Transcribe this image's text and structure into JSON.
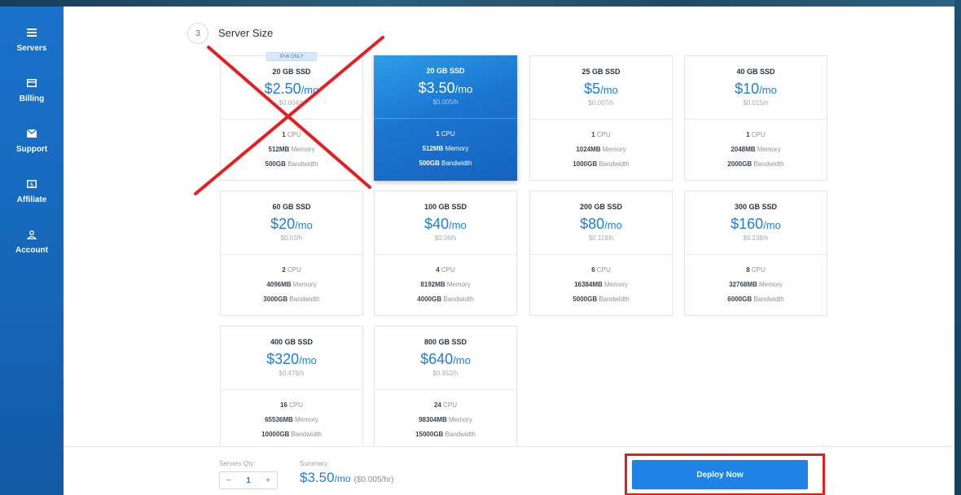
{
  "sidebar": {
    "items": [
      {
        "label": "Servers",
        "icon": "server-icon"
      },
      {
        "label": "Billing",
        "icon": "card-icon"
      },
      {
        "label": "Support",
        "icon": "envelope-icon"
      },
      {
        "label": "Affiliate",
        "icon": "dollar-icon"
      },
      {
        "label": "Account",
        "icon": "user-icon"
      }
    ]
  },
  "section": {
    "step": "3",
    "title": "Server Size"
  },
  "plans": [
    {
      "disk": "20 GB SSD",
      "price": "$2.50",
      "per": "/mo",
      "hourly": "$0.004/h",
      "cpu": "1",
      "cpu_label": "CPU",
      "memory": "512MB",
      "memory_label": "Memory",
      "bandwidth": "500GB",
      "bandwidth_label": "Bandwidth",
      "badge": "IPv6 ONLY"
    },
    {
      "disk": "20 GB SSD",
      "price": "$3.50",
      "per": "/mo",
      "hourly": "$0.005/h",
      "cpu": "1",
      "cpu_label": "CPU",
      "memory": "512MB",
      "memory_label": "Memory",
      "bandwidth": "500GB",
      "bandwidth_label": "Bandwidth"
    },
    {
      "disk": "25 GB SSD",
      "price": "$5",
      "per": "/mo",
      "hourly": "$0.007/h",
      "cpu": "1",
      "cpu_label": "CPU",
      "memory": "1024MB",
      "memory_label": "Memory",
      "bandwidth": "1000GB",
      "bandwidth_label": "Bandwidth"
    },
    {
      "disk": "40 GB SSD",
      "price": "$10",
      "per": "/mo",
      "hourly": "$0.015/h",
      "cpu": "1",
      "cpu_label": "CPU",
      "memory": "2048MB",
      "memory_label": "Memory",
      "bandwidth": "2000GB",
      "bandwidth_label": "Bandwidth"
    },
    {
      "disk": "60 GB SSD",
      "price": "$20",
      "per": "/mo",
      "hourly": "$0.03/h",
      "cpu": "2",
      "cpu_label": "CPU",
      "memory": "4096MB",
      "memory_label": "Memory",
      "bandwidth": "3000GB",
      "bandwidth_label": "Bandwidth"
    },
    {
      "disk": "100 GB SSD",
      "price": "$40",
      "per": "/mo",
      "hourly": "$0.06/h",
      "cpu": "4",
      "cpu_label": "CPU",
      "memory": "8192MB",
      "memory_label": "Memory",
      "bandwidth": "4000GB",
      "bandwidth_label": "Bandwidth"
    },
    {
      "disk": "200 GB SSD",
      "price": "$80",
      "per": "/mo",
      "hourly": "$0.119/h",
      "cpu": "6",
      "cpu_label": "CPU",
      "memory": "16384MB",
      "memory_label": "Memory",
      "bandwidth": "5000GB",
      "bandwidth_label": "Bandwidth"
    },
    {
      "disk": "300 GB SSD",
      "price": "$160",
      "per": "/mo",
      "hourly": "$0.238/h",
      "cpu": "8",
      "cpu_label": "CPU",
      "memory": "32768MB",
      "memory_label": "Memory",
      "bandwidth": "6000GB",
      "bandwidth_label": "Bandwidth"
    },
    {
      "disk": "400 GB SSD",
      "price": "$320",
      "per": "/mo",
      "hourly": "$0.476/h",
      "cpu": "16",
      "cpu_label": "CPU",
      "memory": "65536MB",
      "memory_label": "Memory",
      "bandwidth": "10000GB",
      "bandwidth_label": "Bandwidth"
    },
    {
      "disk": "800 GB SSD",
      "price": "$640",
      "per": "/mo",
      "hourly": "$0.952/h",
      "cpu": "24",
      "cpu_label": "CPU",
      "memory": "98304MB",
      "memory_label": "Memory",
      "bandwidth": "15000GB",
      "bandwidth_label": "Bandwidth"
    }
  ],
  "selected_plan_index": 1,
  "footer": {
    "qty_label": "Servers Qty:",
    "qty_minus": "−",
    "qty_value": "1",
    "qty_plus": "+",
    "summary_label": "Summary:",
    "summary_price": "$3.50",
    "summary_per": "/mo",
    "summary_hourly": "($0.005/hr)",
    "deploy_label": "Deploy Now"
  },
  "colors": {
    "accent": "#1d7ee0",
    "sidebar": "#1a71c9",
    "annotation": "#e81e1e"
  }
}
